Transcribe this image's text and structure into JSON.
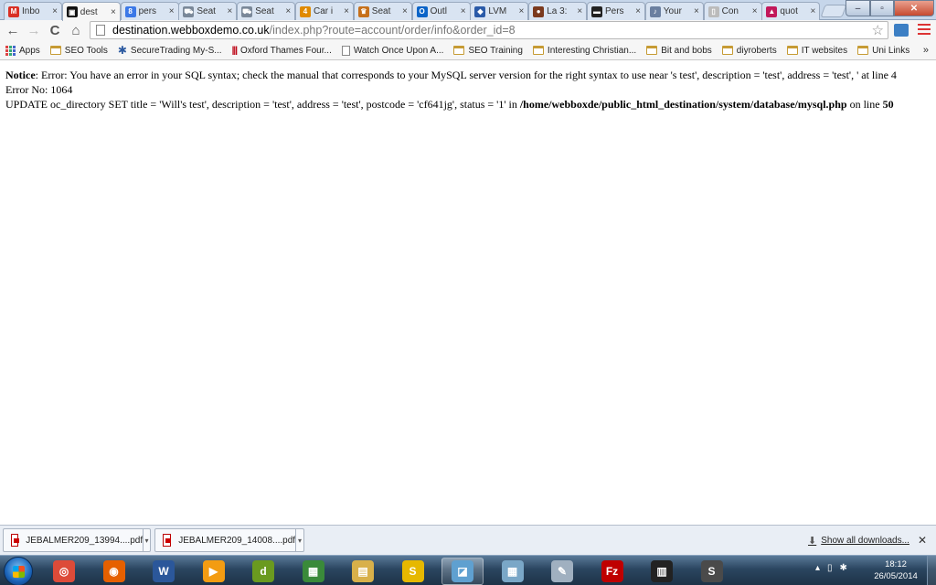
{
  "browser": {
    "tabs": [
      {
        "label": "Inbo",
        "favicon": "gmail-icon",
        "color": "#d93025",
        "glyph": "M"
      },
      {
        "label": "dest",
        "favicon": "dest-icon",
        "color": "#111111",
        "glyph": "▣",
        "active": true
      },
      {
        "label": "pers",
        "favicon": "google-icon",
        "color": "#3b78e7",
        "glyph": "8"
      },
      {
        "label": "Seat",
        "favicon": "car-icon",
        "color": "#7a8899",
        "glyph": "⛟"
      },
      {
        "label": "Seat",
        "favicon": "car-icon",
        "color": "#7a8899",
        "glyph": "⛟"
      },
      {
        "label": "Car i",
        "favicon": "car-insurance-icon",
        "color": "#e08a00",
        "glyph": "4"
      },
      {
        "label": "Seat",
        "favicon": "seat-icon",
        "color": "#c6701a",
        "glyph": "♛"
      },
      {
        "label": "Outl",
        "favicon": "outlook-icon",
        "color": "#0a64c8",
        "glyph": "O"
      },
      {
        "label": "LVM",
        "favicon": "lvm-icon",
        "color": "#2a5aa8",
        "glyph": "◆"
      },
      {
        "label": "La 3:",
        "favicon": "la-icon",
        "color": "#7b3a1e",
        "glyph": "●"
      },
      {
        "label": "Pers",
        "favicon": "pers-icon",
        "color": "#222222",
        "glyph": "▬"
      },
      {
        "label": "Your",
        "favicon": "your-icon",
        "color": "#6a7fa0",
        "glyph": "♪"
      },
      {
        "label": "Con",
        "favicon": "page-icon",
        "color": "#bbbbbb",
        "glyph": "▯"
      },
      {
        "label": "quot",
        "favicon": "quote-icon",
        "color": "#c2185b",
        "glyph": "▲"
      }
    ],
    "tab_close_glyph": "×",
    "window_controls": {
      "minimize": "–",
      "maximize": "▫",
      "close": "✕"
    },
    "nav": {
      "back": "←",
      "forward": "→",
      "reload": "C",
      "home": "⌂"
    },
    "url": {
      "host": "destination.webboxdemo.co.uk",
      "path": "/index.php?route=account/order/info&order_id=8"
    },
    "bookmark_star": "☆",
    "bookmarks": [
      {
        "label": "Apps",
        "icon": "apps-icon"
      },
      {
        "label": "SEO Tools",
        "icon": "folder-icon"
      },
      {
        "label": "SecureTrading My-S...",
        "icon": "gear-icon"
      },
      {
        "label": "Oxford Thames Four...",
        "icon": "bars-icon"
      },
      {
        "label": "Watch Once Upon A...",
        "icon": "page-icon"
      },
      {
        "label": "SEO Training",
        "icon": "folder-icon"
      },
      {
        "label": "Interesting Christian...",
        "icon": "folder-icon"
      },
      {
        "label": "Bit and bobs",
        "icon": "folder-icon"
      },
      {
        "label": "diyroberts",
        "icon": "folder-icon"
      },
      {
        "label": "IT websites",
        "icon": "folder-icon"
      },
      {
        "label": "Uni Links",
        "icon": "folder-icon"
      }
    ],
    "bookmarks_more": "»"
  },
  "page": {
    "notice_label": "Notice",
    "notice_text": ": Error: You have an error in your SQL syntax; check the manual that corresponds to your MySQL server version for the right syntax to use near 's test', description = 'test', address = 'test', ' at line 4",
    "error_no": "Error No: 1064",
    "query_text": "UPDATE oc_directory SET title = 'Will's test', description = 'test', address = 'test', postcode = 'cf641jg', status = '1' in ",
    "file_path": "/home/webboxde/public_html_destination/system/database/mysql.php",
    "on_line_text": " on line ",
    "line_number": "50"
  },
  "downloads": {
    "items": [
      {
        "name": "JEBALMER209_13994....pdf"
      },
      {
        "name": "JEBALMER209_14008....pdf"
      }
    ],
    "dropdown_glyph": "▾",
    "show_all": "Show all downloads...",
    "close_glyph": "✕"
  },
  "taskbar": {
    "apps": [
      {
        "name": "chrome",
        "color": "#dd4b39",
        "glyph": "◎"
      },
      {
        "name": "firefox",
        "color": "#e66000",
        "glyph": "◉"
      },
      {
        "name": "word",
        "color": "#2b579a",
        "glyph": "W"
      },
      {
        "name": "media-player",
        "color": "#f39c12",
        "glyph": "▶"
      },
      {
        "name": "dreamweaver",
        "color": "#6a9a1f",
        "glyph": "d"
      },
      {
        "name": "excel-sheet",
        "color": "#3a8a3a",
        "glyph": "▦"
      },
      {
        "name": "explorer",
        "color": "#d8b04a",
        "glyph": "▤"
      },
      {
        "name": "sw-app",
        "color": "#e6b800",
        "glyph": "S"
      },
      {
        "name": "notes",
        "color": "#5fa0d0",
        "glyph": "◪"
      },
      {
        "name": "calculator",
        "color": "#7aa7c7",
        "glyph": "▦"
      },
      {
        "name": "paint",
        "color": "#a0b0c0",
        "glyph": "✎"
      },
      {
        "name": "filezilla",
        "color": "#bf0000",
        "glyph": "Fz"
      },
      {
        "name": "keyboard-app",
        "color": "#222222",
        "glyph": "▥"
      },
      {
        "name": "sublime",
        "color": "#4a4a4a",
        "glyph": "S"
      }
    ],
    "tray_icons": [
      "▴",
      "▯",
      "✱"
    ],
    "time": "18:12",
    "date": "26/05/2014"
  }
}
